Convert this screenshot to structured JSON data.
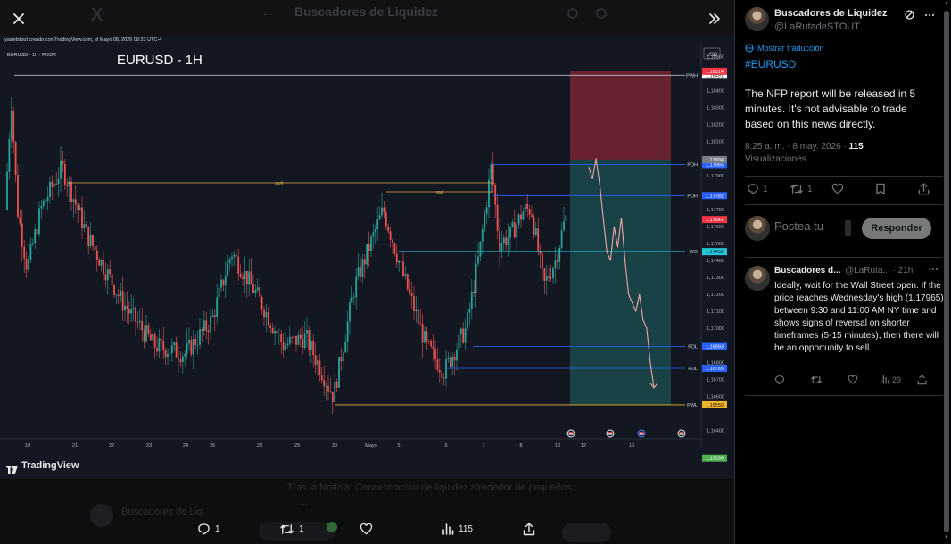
{
  "viewer": {
    "header_title": "Buscadores de Liquidez",
    "chart_caption": "yasielstout creado con TradingView.com, el Mayo 08, 2026 08:23 UTC-4",
    "watermark": "TradingView",
    "below_text_1": "Tras la Noticia: Concentración de liquidez alrededor de pequeños...",
    "below_text_2": "...",
    "below_name": "Buscadores de Liq",
    "actions": {
      "replies": "1",
      "reposts": "1",
      "views": "115"
    }
  },
  "tweet": {
    "name": "Buscadores de Liquidez",
    "handle": "@LaRutadeSTOUT",
    "translate": "Mostrar traducción",
    "hashtag": "#EURUSD",
    "body": "The NFP report will be released in 5 minutes. It's not advisable to trade based on this news directly.",
    "time": "8:25 a. m. · 8 may. 2026 · ",
    "views_count": "115",
    "views_label": "Visualizaciones",
    "stats": {
      "replies": "1",
      "reposts": "1"
    }
  },
  "reply_box": {
    "placeholder": "Postea tu",
    "button": "Responder"
  },
  "reply": {
    "name": "Buscadores d...",
    "handle": "@LaRuta... · 21h",
    "body": "Ideally, wait for the Wall Street open. If the price reaches Wednesday's high (1.17965) between 9:30 and 11:00 AM NY time and shows signs of reversal on shorter timeframes (5-15 minutes), then there will be an opportunity to sell.",
    "views": "29"
  },
  "chart_data": {
    "type": "candlestick",
    "title": "EURUSD - 1H",
    "symbol_label": "EURUSD · 1h · FXCM",
    "currency": "USD",
    "y_ticks": [
      "1,18600",
      "1,18400",
      "1,18300",
      "1,18200",
      "1,18100",
      "1,18000",
      "1,17900",
      "1,17700",
      "1,17600",
      "1,17500",
      "1,17400",
      "1,17300",
      "1,17200",
      "1,17100",
      "1,17000",
      "1,16900",
      "1,16800",
      "1,16700",
      "1,16600",
      "1,16400"
    ],
    "x_ticks": [
      "19",
      "21",
      "22",
      "23",
      "24",
      "26",
      "28",
      "29",
      "30",
      "Mayo",
      "5",
      "6",
      "7",
      "8",
      "10",
      "12",
      "13"
    ],
    "ylim": [
      1.1635,
      1.1865
    ],
    "levels": [
      {
        "name": "PWH",
        "price": 1.18491,
        "color": "#d1d4dc",
        "label_bg": "#ffffff",
        "label_fg": "#131722"
      },
      {
        "name": "PDH",
        "price": 1.17965,
        "color": "#2962ff",
        "label_bg": "#2962ff",
        "label_fg": "#ffffff"
      },
      {
        "name": "PDH",
        "price": 1.17782,
        "color": "#2962ff",
        "label_bg": "#2962ff",
        "label_fg": "#ffffff"
      },
      {
        "name": "WO",
        "price": 1.17452,
        "color": "#22d3ee",
        "label_bg": "#26c6da",
        "label_fg": "#131722"
      },
      {
        "name": "PDL",
        "price": 1.16893,
        "color": "#2962ff",
        "label_bg": "#2962ff",
        "label_fg": "#ffffff"
      },
      {
        "name": "PDL",
        "price": 1.16765,
        "color": "#2962ff",
        "label_bg": "#2962ff",
        "label_fg": "#ffffff"
      },
      {
        "name": "PWL",
        "price": 1.1655,
        "color": "#f0b429",
        "label_bg": "#f0b429",
        "label_fg": "#131722"
      }
    ],
    "price_labels": [
      {
        "value": "1,18514",
        "bg": "#f23645"
      },
      {
        "value": "1,17994",
        "bg": "#787b86"
      },
      {
        "value": "1,17641",
        "bg": "#f23645"
      },
      {
        "value": "1,16236",
        "bg": "#4caf50"
      }
    ],
    "annotations": [
      "pwh",
      "pwl"
    ],
    "short_position": {
      "entry": 1.17994,
      "stop": 1.18514,
      "target": 1.1655
    },
    "projected_path": [
      1.1795,
      1.1788,
      1.18,
      1.1785,
      1.1765,
      1.1745,
      1.174,
      1.176,
      1.1748,
      1.1765,
      1.174,
      1.172,
      1.1715,
      1.171,
      1.172,
      1.1705,
      1.17,
      1.168,
      1.1665
    ]
  },
  "colors": {
    "up": "#26a69a",
    "down": "#ef5350",
    "accent": "#1d9bf0"
  }
}
